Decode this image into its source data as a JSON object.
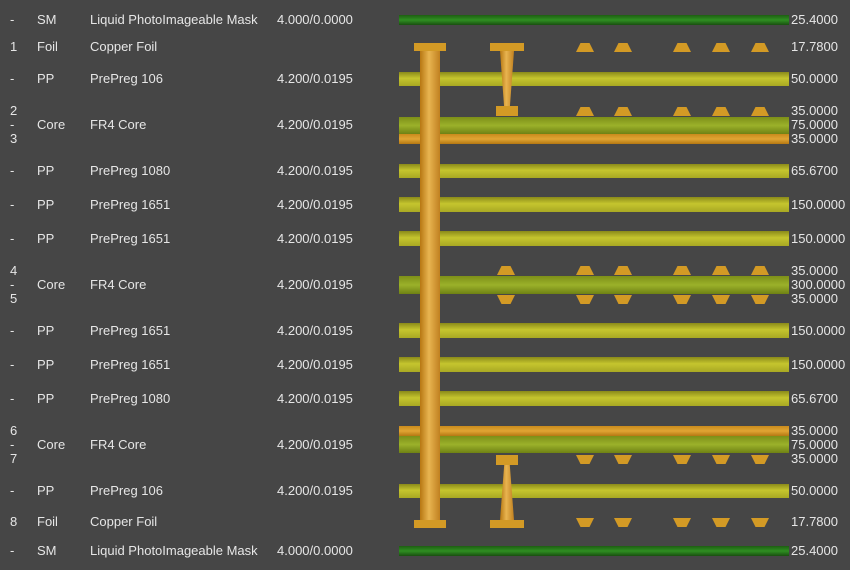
{
  "rows": [
    {
      "num": "-",
      "type": "SM",
      "material": "Liquid PhotoImageable Mask",
      "dk": "4.000/0.0000",
      "thickness": "25.4000"
    },
    {
      "num": "1",
      "type": "Foil",
      "material": "Copper Foil",
      "dk": "",
      "thickness": "17.7800"
    },
    {
      "num": "-",
      "type": "PP",
      "material": "PrePreg 106",
      "dk": "4.200/0.0195",
      "thickness": "50.0000"
    },
    {
      "num": "2\n-\n3",
      "type": "Core",
      "material": "FR4 Core",
      "dk": "4.200/0.0195",
      "thickness": "35.0000\n75.0000\n35.0000"
    },
    {
      "num": "-",
      "type": "PP",
      "material": "PrePreg 1080",
      "dk": "4.200/0.0195",
      "thickness": "65.6700"
    },
    {
      "num": "-",
      "type": "PP",
      "material": "PrePreg 1651",
      "dk": "4.200/0.0195",
      "thickness": "150.0000"
    },
    {
      "num": "-",
      "type": "PP",
      "material": "PrePreg 1651",
      "dk": "4.200/0.0195",
      "thickness": "150.0000"
    },
    {
      "num": "4\n-\n5",
      "type": "Core",
      "material": "FR4 Core",
      "dk": "4.200/0.0195",
      "thickness": "35.0000\n300.0000\n35.0000"
    },
    {
      "num": "-",
      "type": "PP",
      "material": "PrePreg 1651",
      "dk": "4.200/0.0195",
      "thickness": "150.0000"
    },
    {
      "num": "-",
      "type": "PP",
      "material": "PrePreg 1651",
      "dk": "4.200/0.0195",
      "thickness": "150.0000"
    },
    {
      "num": "-",
      "type": "PP",
      "material": "PrePreg 1080",
      "dk": "4.200/0.0195",
      "thickness": "65.6700"
    },
    {
      "num": "6\n-\n7",
      "type": "Core",
      "material": "FR4 Core",
      "dk": "4.200/0.0195",
      "thickness": "35.0000\n75.0000\n35.0000"
    },
    {
      "num": "-",
      "type": "PP",
      "material": "PrePreg 106",
      "dk": "4.200/0.0195",
      "thickness": "50.0000"
    },
    {
      "num": "8",
      "type": "Foil",
      "material": "Copper Foil",
      "dk": "",
      "thickness": "17.7800"
    },
    {
      "num": "-",
      "type": "SM",
      "material": "Liquid PhotoImageable Mask",
      "dk": "4.000/0.0000",
      "thickness": "25.4000"
    }
  ],
  "colors": {
    "background": "#464646",
    "text": "#e6e6e6",
    "solder_mask": "#2f8f22",
    "prepreg": "#c5c52e",
    "core": "#9bb12a",
    "copper": "#e0a533"
  }
}
